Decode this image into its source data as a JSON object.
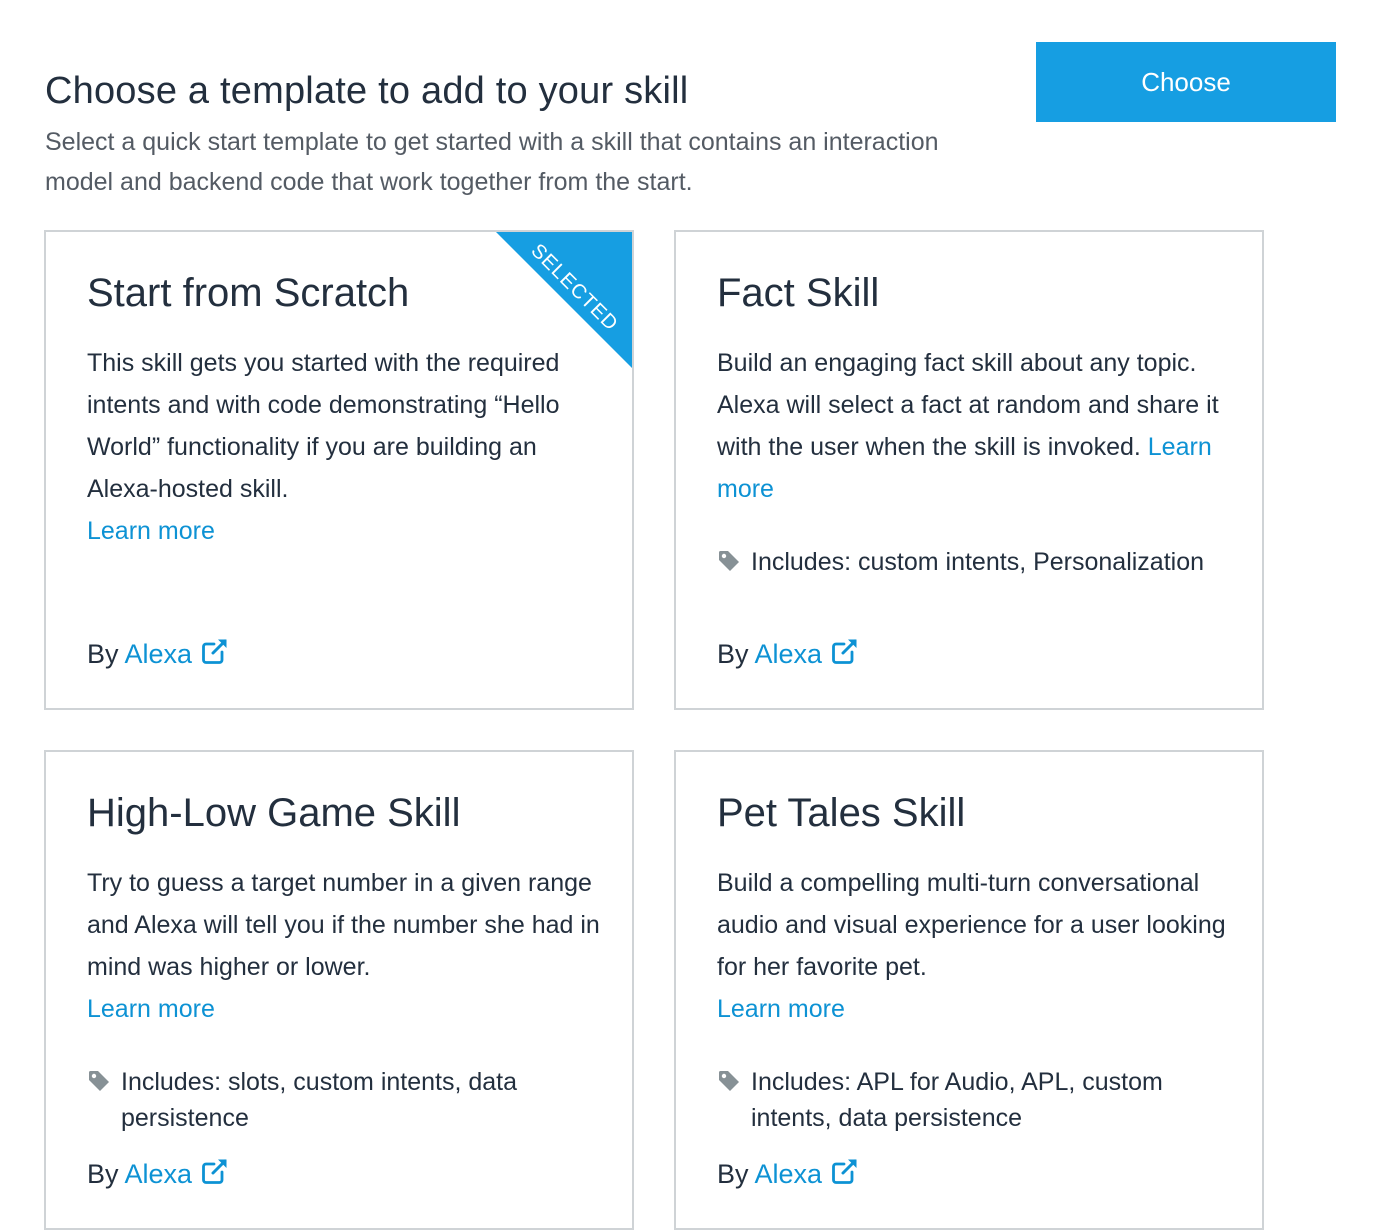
{
  "header": {
    "title": "Choose a template to add to your skill",
    "subtitle": "Select a quick start template to get started with a skill that contains an interaction model and backend code that work together from the start.",
    "choose_label": "Choose"
  },
  "colors": {
    "accent": "#169ee2",
    "link": "#0d92d4",
    "card_border": "#cfd3d6",
    "text": "#232f3e"
  },
  "cards": [
    {
      "title": "Start from Scratch",
      "description": "This skill gets you started with the required intents and with code demonstrating “Hello World” functionality if you are building an Alexa-hosted skill.",
      "learn_more": "Learn more",
      "includes": "",
      "by": "By",
      "author": "Alexa",
      "selected": true,
      "ribbon": "SELECTED"
    },
    {
      "title": "Fact Skill",
      "description": "Build an engaging fact skill about any topic. Alexa will select a fact at random and share it with the user when the skill is invoked.",
      "learn_more": "Learn more",
      "includes": "Includes: custom intents, Personalization",
      "by": "By",
      "author": "Alexa",
      "selected": false
    },
    {
      "title": "High-Low Game Skill",
      "description": "Try to guess a target number in a given range and Alexa will tell you if the number she had in mind was higher or lower.",
      "learn_more": "Learn more",
      "includes": "Includes: slots, custom intents, data persistence",
      "by": "By",
      "author": "Alexa",
      "selected": false
    },
    {
      "title": "Pet Tales Skill",
      "description": "Build a compelling multi-turn conversational audio and visual experience for a user looking for her favorite pet.",
      "learn_more": "Learn more",
      "includes": "Includes: APL for Audio, APL, custom intents, data persistence",
      "by": "By",
      "author": "Alexa",
      "selected": false
    }
  ]
}
